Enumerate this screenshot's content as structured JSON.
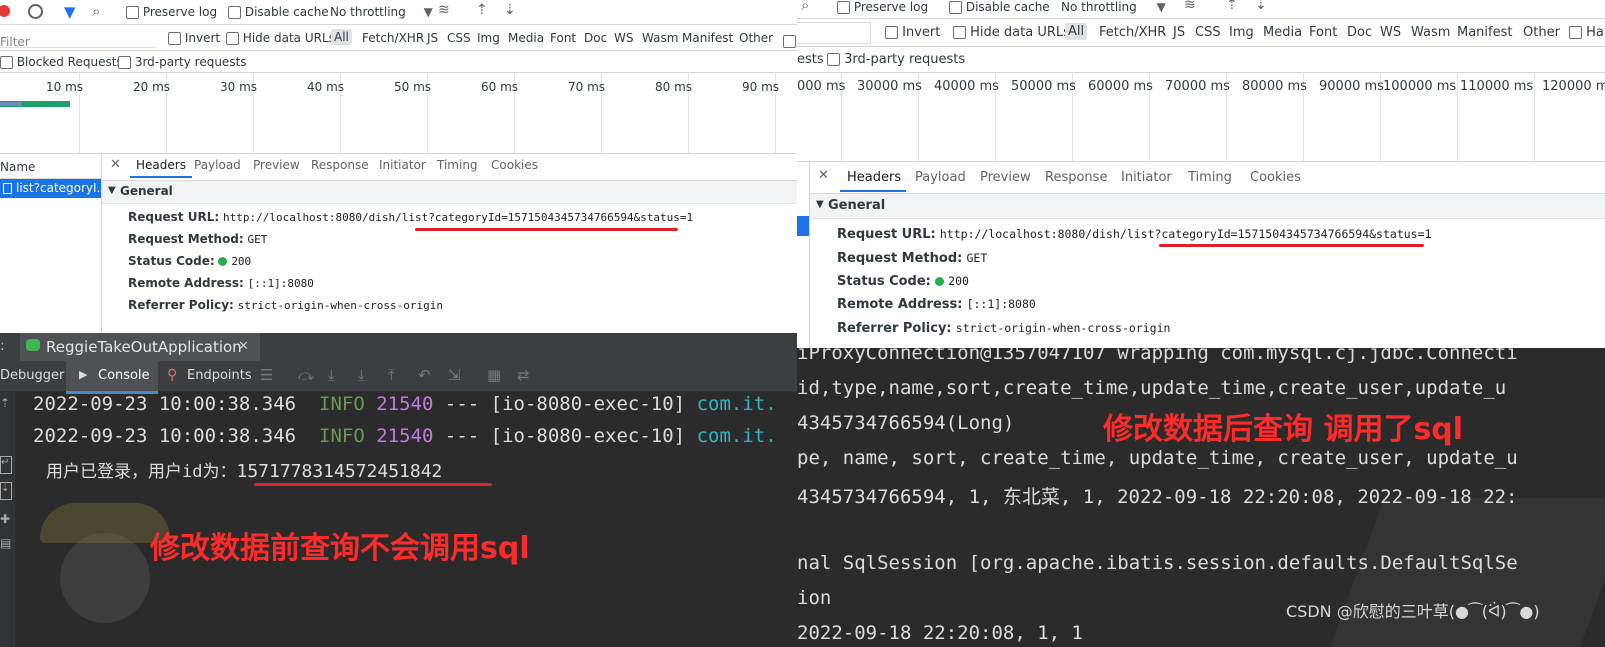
{
  "left": {
    "toolbar": {
      "preserve_log": "Preserve log",
      "disable_cache": "Disable cache",
      "throttling": "No throttling"
    },
    "filter": {
      "placeholder": "Filter",
      "invert": "Invert",
      "hide_data_urls": "Hide data URLs",
      "types": [
        "All",
        "Fetch/XHR",
        "JS",
        "CSS",
        "Img",
        "Media",
        "Font",
        "Doc",
        "WS",
        "Wasm",
        "Manifest",
        "Other"
      ]
    },
    "blocked_requests": "Blocked Requests",
    "third_party": "3rd-party requests",
    "timeline": [
      "10 ms",
      "20 ms",
      "30 ms",
      "40 ms",
      "50 ms",
      "60 ms",
      "70 ms",
      "80 ms",
      "90 ms"
    ],
    "name_header": "Name",
    "request_item": "list?categoryI...",
    "tabs": [
      "Headers",
      "Payload",
      "Preview",
      "Response",
      "Initiator",
      "Timing",
      "Cookies"
    ],
    "general": "General",
    "headers": [
      {
        "label": "Request URL:",
        "value": "http://localhost:8080/dish/list?categoryId=1571504345734766594&status=1"
      },
      {
        "label": "Request Method:",
        "value": "GET"
      },
      {
        "label": "Status Code:",
        "value": "200"
      },
      {
        "label": "Remote Address:",
        "value": "[::1]:8080"
      },
      {
        "label": "Referrer Policy:",
        "value": "strict-origin-when-cross-origin"
      }
    ],
    "app_tab": "ReggieTakeOutApplication",
    "console_tabs": {
      "debugger": "Debugger",
      "console": "Console",
      "endpoints": "Endpoints"
    },
    "log_lines": [
      {
        "time": "2022-09-23 10:00:38.346",
        "level": "INFO",
        "pid": "21540",
        "sep": "---",
        "thread": "[io-8080-exec-10]",
        "logger": "com.it."
      },
      {
        "time": "2022-09-23 10:00:38.346",
        "level": "INFO",
        "pid": "21540",
        "sep": "---",
        "thread": "[io-8080-exec-10]",
        "logger": "com.it."
      }
    ],
    "user_line_prefix": "用户已登录，用户id为：",
    "user_id": "1571778314572451842",
    "annotation": "修改数据前查询不会调用sql"
  },
  "right": {
    "toolbar": {
      "preserve_log": "Preserve log",
      "disable_cache": "Disable cache",
      "throttling": "No throttling"
    },
    "filter": {
      "invert": "Invert",
      "hide_data_urls": "Hide data URLs",
      "types": [
        "All",
        "Fetch/XHR",
        "JS",
        "CSS",
        "Img",
        "Media",
        "Font",
        "Doc",
        "WS",
        "Wasm",
        "Manifest",
        "Other",
        "Ha"
      ]
    },
    "blocked_partial": "ests",
    "third_party": "3rd-party requests",
    "timeline": [
      "000 ms",
      "30000 ms",
      "40000 ms",
      "50000 ms",
      "60000 ms",
      "70000 ms",
      "80000 ms",
      "90000 ms",
      "100000 ms",
      "110000 ms",
      "120000 m"
    ],
    "tabs": [
      "Headers",
      "Payload",
      "Preview",
      "Response",
      "Initiator",
      "Timing",
      "Cookies"
    ],
    "general": "General",
    "headers": [
      {
        "label": "Request URL:",
        "value": "http://localhost:8080/dish/list?categoryId=1571504345734766594&status=1"
      },
      {
        "label": "Request Method:",
        "value": "GET"
      },
      {
        "label": "Status Code:",
        "value": "200"
      },
      {
        "label": "Remote Address:",
        "value": "[::1]:8080"
      },
      {
        "label": "Referrer Policy:",
        "value": "strict-origin-when-cross-origin"
      }
    ],
    "console_lines": [
      "iProxyConnection@1357047107 wrapping com.mysql.cj.jdbc.Connecti",
      " id,type,name,sort,create_time,update_time,create_user,update_u",
      "4345734766594(Long)",
      "pe, name, sort, create_time, update_time, create_user, update_u",
      "4345734766594, 1, 东北菜, 1, 2022-09-18 22:20:08, 2022-09-18 22:",
      "",
      "nal SqlSession [org.apache.ibatis.session.defaults.DefaultSqlSe",
      "ion",
      "  2022-09-18 22:20:08, 1, 1"
    ],
    "annotation": "修改数据后查询 调用了sql",
    "watermark": "CSDN @欣慰的三叶草(●⁀(ᐛ)⁀●)"
  }
}
